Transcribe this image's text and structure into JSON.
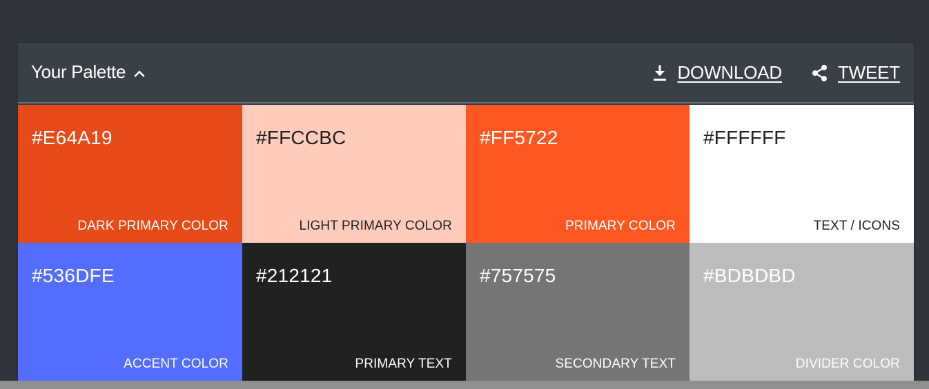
{
  "header": {
    "title": "Your Palette",
    "title_icon": "chevron-up-icon",
    "download_label": "DOWNLOAD",
    "download_icon": "download-icon",
    "tweet_label": "TWEET",
    "tweet_icon": "share-icon"
  },
  "swatches": [
    {
      "hex": "#E64A19",
      "role": "DARK PRIMARY COLOR",
      "bg": "#E64A19",
      "fg": "#FFFFFF"
    },
    {
      "hex": "#FFCCBC",
      "role": "LIGHT PRIMARY COLOR",
      "bg": "#FFCCBC",
      "fg": "#212121"
    },
    {
      "hex": "#FF5722",
      "role": "PRIMARY COLOR",
      "bg": "#FF5722",
      "fg": "#FFFFFF"
    },
    {
      "hex": "#FFFFFF",
      "role": "TEXT / ICONS",
      "bg": "#FFFFFF",
      "fg": "#212121"
    },
    {
      "hex": "#536DFE",
      "role": "ACCENT COLOR",
      "bg": "#536DFE",
      "fg": "#FFFFFF"
    },
    {
      "hex": "#212121",
      "role": "PRIMARY TEXT",
      "bg": "#212121",
      "fg": "#FFFFFF"
    },
    {
      "hex": "#757575",
      "role": "SECONDARY TEXT",
      "bg": "#757575",
      "fg": "#FFFFFF"
    },
    {
      "hex": "#BDBDBD",
      "role": "DIVIDER COLOR",
      "bg": "#BDBDBD",
      "fg": "#FFFFFF"
    }
  ]
}
